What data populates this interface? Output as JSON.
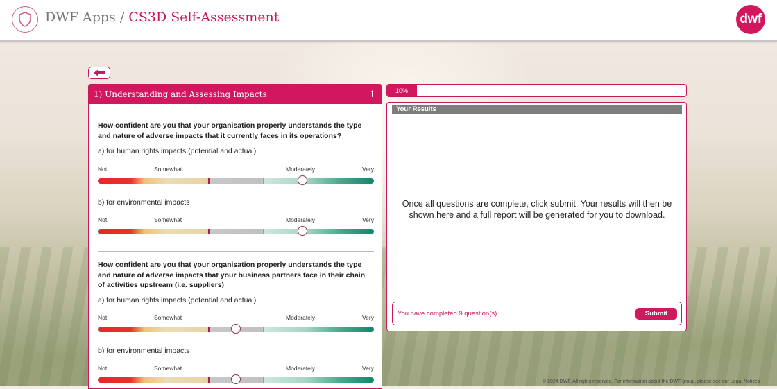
{
  "header": {
    "app_name": "DWF Apps",
    "separator": "/",
    "page_title": "CS3D Self-Assessment",
    "logo_text": "dwf"
  },
  "section": {
    "title": "1) Understanding and Assessing Impacts",
    "collapse_arrow": "↑"
  },
  "scale": {
    "not": "Not",
    "somewhat": "Somewhat",
    "moderately": "Moderately",
    "very": "Very"
  },
  "questions": [
    {
      "text": "How confident are you that your organisation properly understands the type and nature of adverse impacts that it currently faces in its operations?",
      "items": [
        {
          "label": "a) for human rights impacts (potential and actual)",
          "value": 0.74
        },
        {
          "label": "b) for environmental impacts",
          "value": 0.74
        }
      ]
    },
    {
      "text": "How confident are you that your organisation properly understands the type and nature of adverse impacts that your business partners face in their chain of activities upstream (i.e. suppliers)",
      "items": [
        {
          "label": "a) for human rights impacts (potential and actual)",
          "value": 0.5
        },
        {
          "label": "b) for environmental impacts",
          "value": 0.5
        }
      ]
    }
  ],
  "progress": {
    "label": "10%",
    "value": 0.1
  },
  "results": {
    "title": "Your Results",
    "message": "Once all questions are complete, click submit. Your results will then be shown here and a full report will be generated for you to download.",
    "completed_text": "You have completed 9 question(s).",
    "submit_label": "Submit"
  },
  "footer": {
    "text": "© 2024 DWF. All rights reserved. For information about the DWF group, please see our Legal Notices"
  },
  "colors": {
    "brand": "#d3175e",
    "grey_header": "#7d7d7d"
  },
  "icons": {
    "header_logo": "shield-icon",
    "back": "arrow-left-icon"
  }
}
